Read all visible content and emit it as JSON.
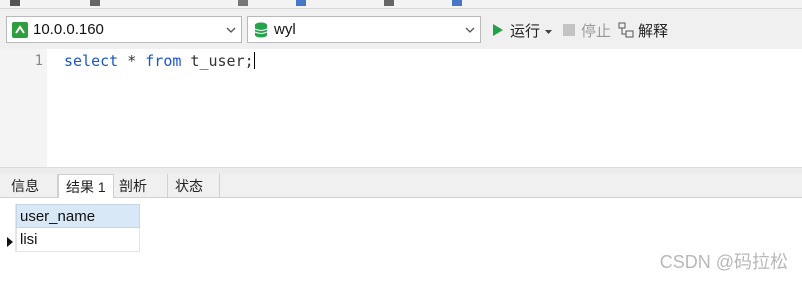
{
  "connection": {
    "host": "10.0.0.160",
    "database": "wyl"
  },
  "actions": {
    "run_label": "运行",
    "stop_label": "停止",
    "explain_label": "解释"
  },
  "editor": {
    "line_number": "1",
    "kw_select": "select",
    "star": " * ",
    "kw_from": "from",
    "table_part": " t_user;"
  },
  "result_tabs": [
    {
      "label": "信息"
    },
    {
      "label": "结果 1"
    },
    {
      "label": "剖析"
    },
    {
      "label": "状态"
    }
  ],
  "result_grid": {
    "columns": [
      "user_name"
    ],
    "rows": [
      [
        "lisi"
      ]
    ]
  },
  "watermark": "CSDN @码拉松",
  "colors": {
    "accent_green": "#22a04a",
    "keyword_blue": "#1a55c9",
    "header_blue": "#d9e8f6"
  }
}
